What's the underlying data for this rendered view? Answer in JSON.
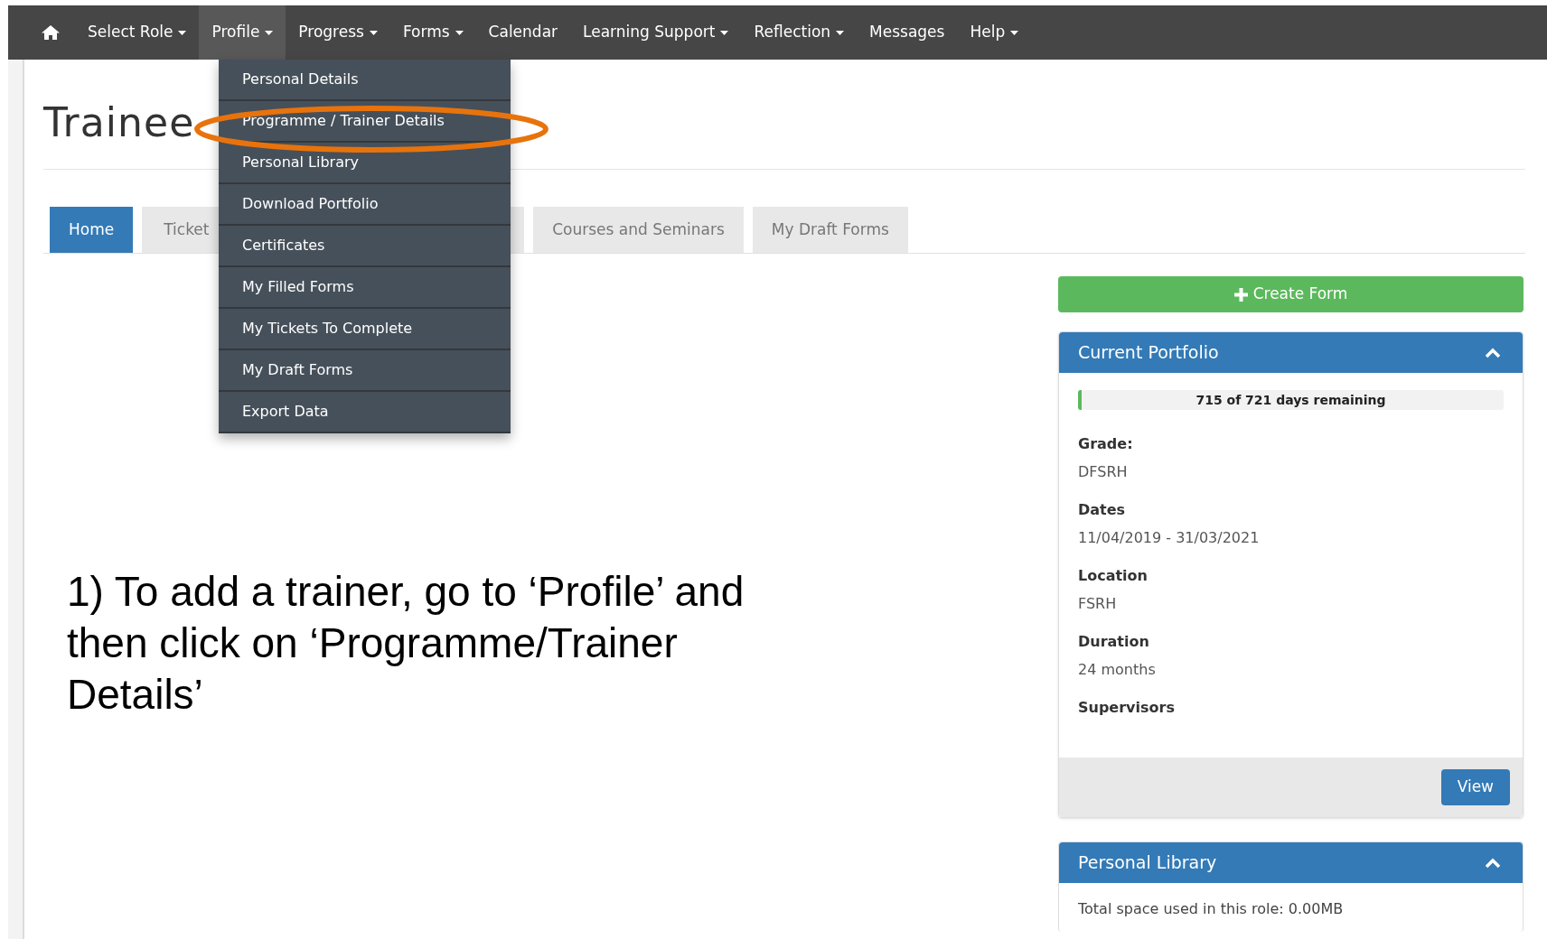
{
  "nav": {
    "items": [
      {
        "label": "Select Role",
        "dropdown": true,
        "selected": false
      },
      {
        "label": "Profile",
        "dropdown": true,
        "selected": true
      },
      {
        "label": "Progress",
        "dropdown": true,
        "selected": false
      },
      {
        "label": "Forms",
        "dropdown": true,
        "selected": false
      },
      {
        "label": "Calendar",
        "dropdown": false,
        "selected": false
      },
      {
        "label": "Learning Support",
        "dropdown": true,
        "selected": false
      },
      {
        "label": "Reflection",
        "dropdown": true,
        "selected": false
      },
      {
        "label": "Messages",
        "dropdown": false,
        "selected": false
      },
      {
        "label": "Help",
        "dropdown": true,
        "selected": false
      }
    ]
  },
  "dropdown_menu": {
    "items": [
      {
        "label": "Personal Details",
        "circled": false
      },
      {
        "label": "Programme / Trainer Details",
        "circled": true
      },
      {
        "label": "Personal Library",
        "circled": false
      },
      {
        "label": "Download Portfolio",
        "circled": false
      },
      {
        "label": "Certificates",
        "circled": false
      },
      {
        "label": "My Filled Forms",
        "circled": false
      },
      {
        "label": "My Tickets To Complete",
        "circled": false
      },
      {
        "label": "My Draft Forms",
        "circled": false
      },
      {
        "label": "Export Data",
        "circled": false
      }
    ]
  },
  "page": {
    "title": "Trainee",
    "tabs": [
      {
        "label": "Home",
        "selected": true
      },
      {
        "label": "Ticket",
        "selected": false
      },
      {
        "label": "Courses and Seminars",
        "selected": false
      },
      {
        "label": "My Draft Forms",
        "selected": false
      }
    ]
  },
  "instruction": "1) To add a trainer, go to ‘Profile’ and then click on ‘Programme/Trainer Details’",
  "create_button": "Create Form",
  "portfolio": {
    "title": "Current Portfolio",
    "expanded": true,
    "progress": {
      "level": 0.008,
      "reading": "715 of 721 days remaining"
    },
    "fields": [
      {
        "label": "Grade:",
        "value": "DFSRH"
      },
      {
        "label": "Dates",
        "value": "11/04/2019 - 31/03/2021"
      },
      {
        "label": "Location",
        "value": "FSRH"
      },
      {
        "label": "Duration",
        "value": "24 months"
      },
      {
        "label": "Supervisors"
      }
    ],
    "footer_button": "View"
  },
  "library": {
    "title": "Personal Library",
    "expanded": true,
    "text": "Total space used in this role: 0.00MB"
  }
}
